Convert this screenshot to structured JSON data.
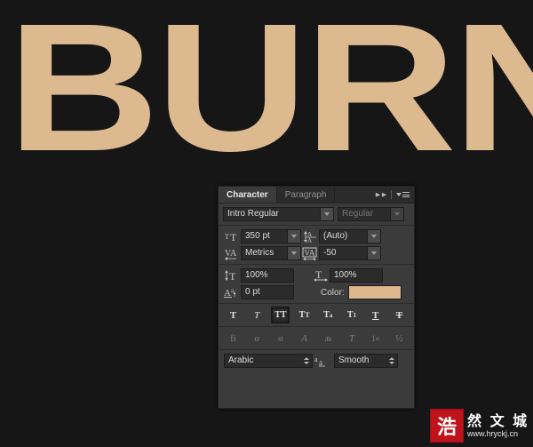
{
  "canvas": {
    "text": "BURN",
    "text_color": "#ddb990",
    "background_color": "#161616"
  },
  "panel": {
    "tabs": [
      {
        "label": "Character",
        "active": true
      },
      {
        "label": "Paragraph",
        "active": false
      }
    ],
    "header_icons": {
      "collapse": "double-right-arrow-icon",
      "menu": "panel-menu-icon"
    },
    "font": {
      "family_value": "Intro  Regular",
      "style_value": "Regular"
    },
    "metrics": {
      "size_icon": "font-size-icon",
      "size_value": "350 pt",
      "leading_icon": "leading-icon",
      "leading_value": "(Auto)",
      "kerning_icon": "kerning-icon",
      "kerning_value": "Metrics",
      "tracking_icon": "tracking-icon",
      "tracking_value": "-50"
    },
    "scale": {
      "vertical_icon": "vertical-scale-icon",
      "vertical_value": "100%",
      "horizontal_icon": "horizontal-scale-icon",
      "horizontal_value": "100%",
      "baseline_icon": "baseline-shift-icon",
      "baseline_value": "0 pt",
      "color_label": "Color:",
      "color_value": "#dcb78e"
    },
    "style_buttons": [
      {
        "name": "faux-bold",
        "glyph": "T",
        "state": "normal"
      },
      {
        "name": "faux-italic",
        "glyph": "T",
        "state": "italic"
      },
      {
        "name": "all-caps",
        "glyph": "TT",
        "state": "active"
      },
      {
        "name": "small-caps",
        "glyph": "Tт",
        "state": "normal"
      },
      {
        "name": "superscript",
        "glyph": "T",
        "state": "normal"
      },
      {
        "name": "subscript",
        "glyph": "T",
        "state": "normal"
      },
      {
        "name": "underline",
        "glyph": "T",
        "state": "normal"
      },
      {
        "name": "strikethrough",
        "glyph": "T",
        "state": "normal"
      }
    ],
    "opentype_buttons": [
      {
        "name": "standard-ligatures",
        "glyph": "fi"
      },
      {
        "name": "contextual-alternates",
        "glyph": "α"
      },
      {
        "name": "discretionary-ligatures",
        "glyph": "st"
      },
      {
        "name": "swash",
        "glyph": "A"
      },
      {
        "name": "old-style",
        "glyph": "aa"
      },
      {
        "name": "titling-alternates",
        "glyph": "T"
      },
      {
        "name": "ordinals",
        "glyph": "1st"
      },
      {
        "name": "fractions",
        "glyph": "½"
      }
    ],
    "bottom": {
      "language_value": "Arabic",
      "antialias_icon": "anti-alias-icon",
      "antialias_value": "Smooth"
    }
  },
  "watermark": {
    "seal_char": "浩",
    "chinese_text": "然 文 城",
    "url": "www.hryckj.cn",
    "seal_color": "#c0121a"
  }
}
